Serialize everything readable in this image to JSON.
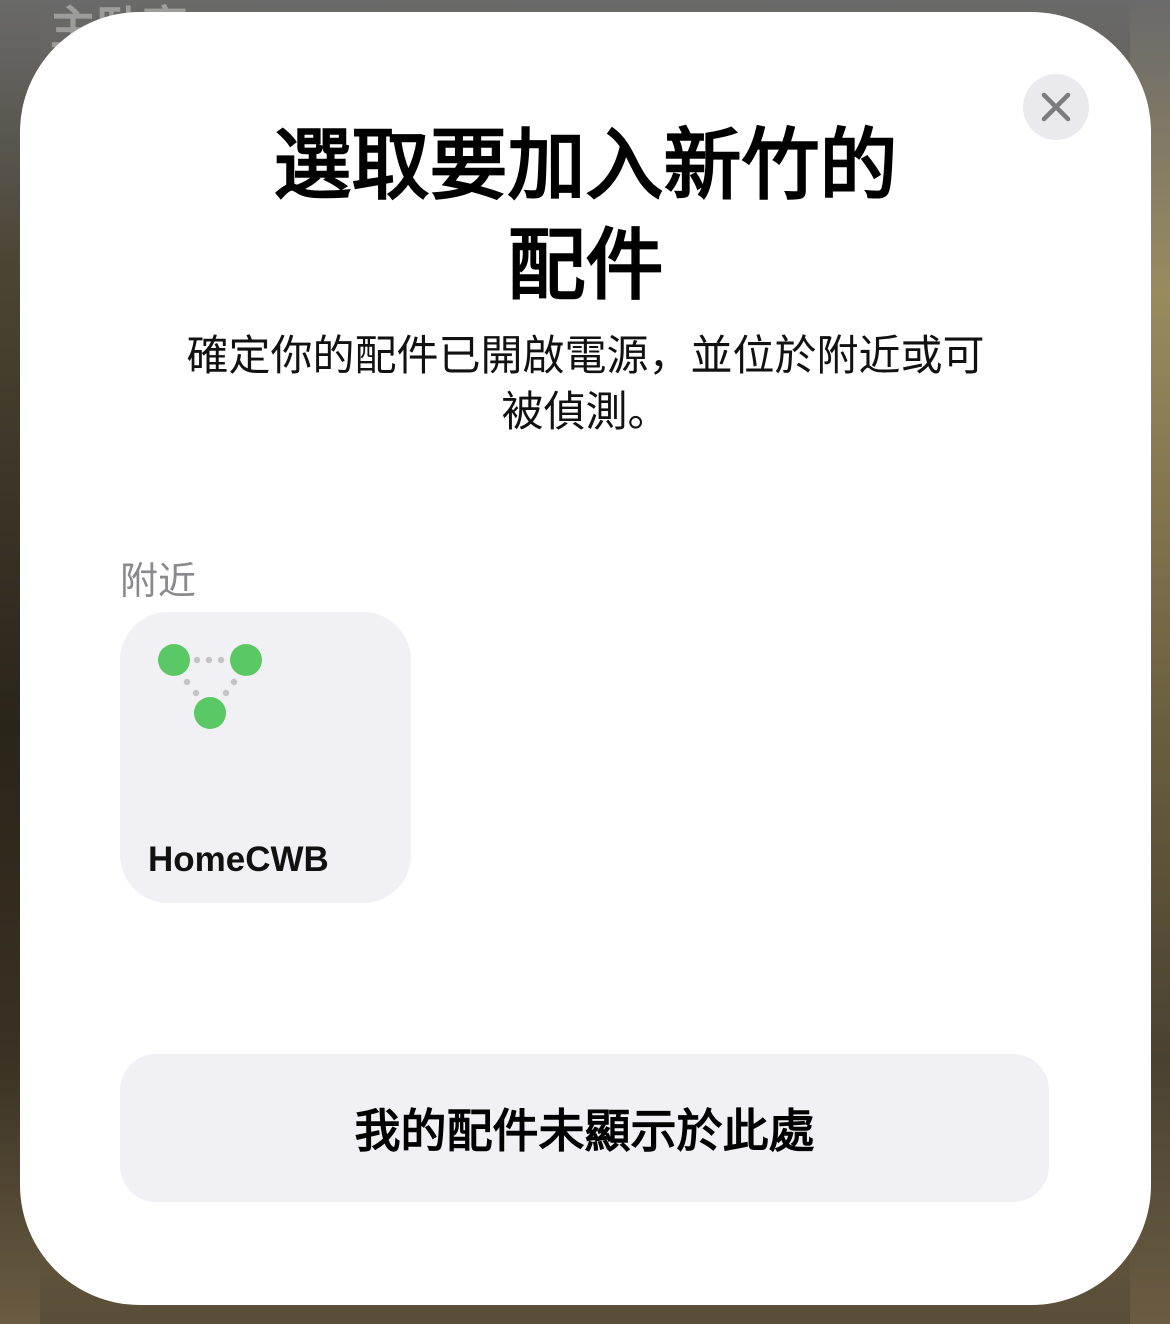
{
  "background": {
    "partial_text": "主臥室"
  },
  "dialog": {
    "title_line1": "選取要加入新竹的",
    "title_line2": "配件",
    "subtitle_line1": "確定你的配件已開啟電源，並位於附近或可",
    "subtitle_line2": "被偵測。",
    "close_icon": "close-icon",
    "section_label": "附近",
    "accessories": [
      {
        "name": "HomeCWB",
        "icon": "mesh-network-icon",
        "icon_color": "#5ac864"
      }
    ],
    "bottom_button_label": "我的配件未顯示於此處"
  }
}
